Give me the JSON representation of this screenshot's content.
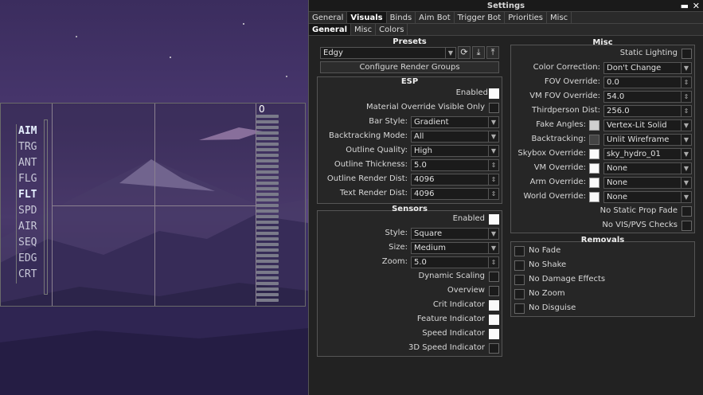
{
  "window": {
    "title": "Settings",
    "min_glyph": "▬",
    "close_glyph": "✕"
  },
  "tabs": [
    "General",
    "Visuals",
    "Binds",
    "Aim Bot",
    "Trigger Bot",
    "Priorities",
    "Misc"
  ],
  "subtabs": [
    "General",
    "Misc",
    "Colors"
  ],
  "hud": {
    "counter": "0",
    "labels": [
      "AIM",
      "TRG",
      "ANT",
      "FLG",
      "FLT",
      "SPD",
      "AIR",
      "SEQ",
      "EDG",
      "CRT"
    ]
  },
  "presets": {
    "header": "Presets",
    "value": "Edgy",
    "refresh_icon": "⟳",
    "download_icon": "⤓",
    "upload_icon": "⤒",
    "configure_label": "Configure Render Groups"
  },
  "esp": {
    "header": "ESP",
    "enabled": "Enabled",
    "material_override": "Material Override Visible Only",
    "bar_style": "Bar Style:",
    "bar_style_value": "Gradient",
    "backtracking_mode": "Backtracking Mode:",
    "backtracking_mode_value": "All",
    "outline_quality": "Outline Quality:",
    "outline_quality_value": "High",
    "outline_thickness": "Outline Thickness:",
    "outline_thickness_value": "5.0",
    "outline_render_dist": "Outline Render Dist:",
    "outline_render_dist_value": "4096",
    "text_render_dist": "Text Render Dist:",
    "text_render_dist_value": "4096"
  },
  "sensors": {
    "header": "Sensors",
    "enabled": "Enabled",
    "style": "Style:",
    "style_value": "Square",
    "size": "Size:",
    "size_value": "Medium",
    "zoom": "Zoom:",
    "zoom_value": "5.0",
    "dynamic_scaling": "Dynamic Scaling",
    "overview": "Overview",
    "crit_indicator": "Crit Indicator",
    "feature_indicator": "Feature Indicator",
    "speed_indicator": "Speed Indicator",
    "speed3d_indicator": "3D Speed Indicator"
  },
  "misc": {
    "header": "Misc",
    "static_lighting": "Static Lighting",
    "color_correction": "Color Correction:",
    "color_correction_value": "Don't Change",
    "fov_override": "FOV Override:",
    "fov_override_value": "0.0",
    "vm_fov_override": "VM FOV Override:",
    "vm_fov_override_value": "54.0",
    "thirdperson_dist": "Thirdperson Dist:",
    "thirdperson_dist_value": "256.0",
    "fake_angles": "Fake Angles:",
    "fake_angles_value": "Vertex-Lit Solid",
    "backtracking": "Backtracking:",
    "backtracking_value": "Unlit Wireframe",
    "skybox_override": "Skybox Override:",
    "skybox_override_value": "sky_hydro_01",
    "vm_override": "VM Override:",
    "vm_override_value": "None",
    "arm_override": "Arm Override:",
    "arm_override_value": "None",
    "world_override": "World Override:",
    "world_override_value": "None",
    "no_static_prop_fade": "No Static Prop Fade",
    "no_vis_pvs": "No VIS/PVS Checks"
  },
  "removals": {
    "header": "Removals",
    "items": [
      "No Fade",
      "No Shake",
      "No Damage Effects",
      "No Zoom",
      "No Disguise"
    ]
  }
}
